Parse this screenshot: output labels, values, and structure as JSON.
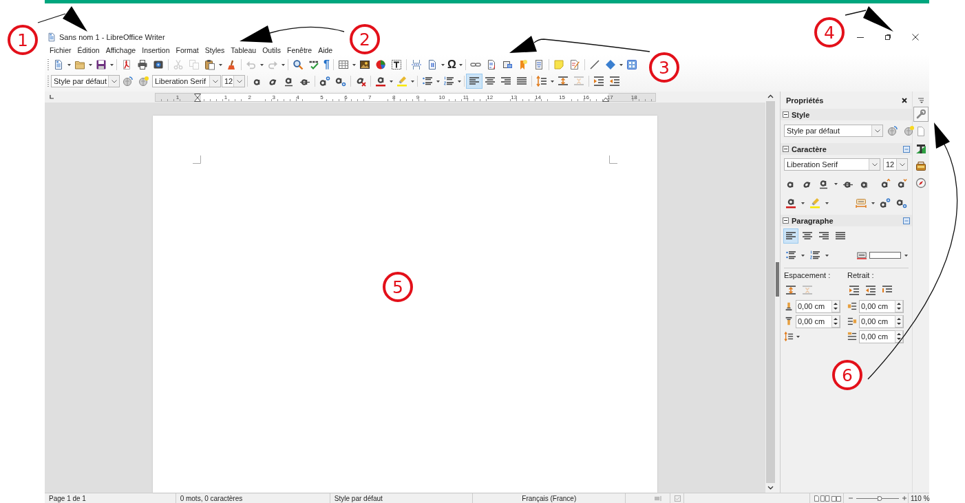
{
  "window": {
    "title": "Sans nom 1 - LibreOffice Writer"
  },
  "menu": [
    {
      "label": "Fichier"
    },
    {
      "label": "Édition"
    },
    {
      "label": "Affichage"
    },
    {
      "label": "Insertion"
    },
    {
      "label": "Format"
    },
    {
      "label": "Styles"
    },
    {
      "label": "Tableau"
    },
    {
      "label": "Outils"
    },
    {
      "label": "Fenêtre"
    },
    {
      "label": "Aide"
    }
  ],
  "toolbars": [
    {
      "groups": [
        [
          {
            "kind": "document",
            "dropdown": true,
            "disabled": false,
            "selected": false
          },
          {
            "kind": "folder",
            "dropdown": true,
            "disabled": false,
            "selected": false
          },
          {
            "kind": "floppy-disk",
            "dropdown": true,
            "disabled": false,
            "selected": false
          }
        ],
        [
          {
            "kind": "pdf",
            "disabled": false,
            "selected": false
          },
          {
            "kind": "printer",
            "disabled": false,
            "selected": false
          },
          {
            "kind": "print-preview",
            "disabled": false,
            "selected": false
          }
        ],
        [
          {
            "kind": "scissors",
            "disabled": true,
            "selected": false
          },
          {
            "kind": "copy",
            "disabled": true,
            "selected": false
          },
          {
            "kind": "clipboard",
            "dropdown": true,
            "disabled": false,
            "selected": false
          },
          {
            "kind": "brush",
            "disabled": false,
            "selected": false
          }
        ],
        [
          {
            "kind": "undo",
            "dropdown": true,
            "disabled": true,
            "selected": false
          },
          {
            "kind": "redo",
            "dropdown": true,
            "disabled": true,
            "selected": false
          }
        ],
        [
          {
            "kind": "magnifier",
            "disabled": false,
            "selected": false
          },
          {
            "kind": "spellcheck",
            "disabled": false,
            "selected": false
          },
          {
            "kind": "pilcrow",
            "text": "¶",
            "color": "#1f6fc9",
            "disabled": false,
            "selected": false
          }
        ],
        [
          {
            "kind": "table",
            "dropdown": true,
            "disabled": false,
            "selected": false
          },
          {
            "kind": "image",
            "disabled": false,
            "selected": false
          },
          {
            "kind": "pie-chart",
            "disabled": false,
            "selected": false
          },
          {
            "kind": "text-frame",
            "disabled": false,
            "selected": false
          }
        ],
        [
          {
            "kind": "page-break",
            "disabled": false,
            "selected": false
          },
          {
            "kind": "field",
            "dropdown": true,
            "disabled": false,
            "selected": false
          },
          {
            "kind": "omega",
            "text": "Ω",
            "color": "#222222",
            "dropdown": true,
            "disabled": false,
            "selected": false
          }
        ],
        [
          {
            "kind": "chain",
            "disabled": false,
            "selected": false
          },
          {
            "kind": "footnote",
            "disabled": false,
            "selected": false
          },
          {
            "kind": "endnote",
            "disabled": false,
            "selected": false
          },
          {
            "kind": "bookmark",
            "disabled": false,
            "selected": false
          },
          {
            "kind": "cross-reference",
            "disabled": false,
            "selected": false
          }
        ],
        [
          {
            "kind": "sticky-note",
            "disabled": false,
            "selected": false
          },
          {
            "kind": "track-changes",
            "disabled": false,
            "selected": false
          }
        ],
        [
          {
            "kind": "line",
            "disabled": false,
            "selected": false
          },
          {
            "kind": "diamond",
            "dropdown": true,
            "disabled": false,
            "selected": false
          },
          {
            "kind": "grid",
            "disabled": false,
            "selected": false
          }
        ]
      ]
    },
    {
      "groups": [
        [
          {
            "kind": "style-field",
            "value": "Style par défaut"
          },
          {
            "kind": "globe-refresh",
            "disabled": false,
            "selected": false
          },
          {
            "kind": "globe-star",
            "disabled": false,
            "selected": false
          },
          {
            "kind": "font-field",
            "value": "Liberation Serif"
          },
          {
            "kind": "size-field",
            "value": "12"
          }
        ],
        [
          {
            "kind": "bold",
            "disabled": false,
            "selected": false
          },
          {
            "kind": "italic",
            "disabled": false,
            "selected": false
          },
          {
            "kind": "underline",
            "disabled": false,
            "selected": false
          },
          {
            "kind": "strikethrough",
            "disabled": false,
            "selected": false
          }
        ],
        [
          {
            "kind": "superscript",
            "disabled": false,
            "selected": false
          },
          {
            "kind": "subscript",
            "disabled": false,
            "selected": false
          }
        ],
        [
          {
            "kind": "clear-formatting",
            "disabled": false,
            "selected": false
          }
        ],
        [
          {
            "kind": "font-color",
            "dropdown": true,
            "disabled": false,
            "selected": false
          },
          {
            "kind": "highlight",
            "dropdown": true,
            "disabled": false,
            "selected": false
          }
        ],
        [
          {
            "kind": "bullets",
            "dropdown": true,
            "disabled": false,
            "selected": false
          },
          {
            "kind": "numbering",
            "dropdown": true,
            "disabled": false,
            "selected": false
          }
        ],
        [
          {
            "kind": "align-left",
            "disabled": false,
            "selected": true
          },
          {
            "kind": "align-center",
            "disabled": false,
            "selected": false
          },
          {
            "kind": "align-right",
            "disabled": false,
            "selected": false
          },
          {
            "kind": "justify",
            "disabled": false,
            "selected": false
          }
        ],
        [
          {
            "kind": "line-spacing",
            "dropdown": true,
            "disabled": false,
            "selected": false
          },
          {
            "kind": "space-increase",
            "disabled": false,
            "selected": false
          },
          {
            "kind": "space-decrease",
            "disabled": true,
            "selected": false
          }
        ],
        [
          {
            "kind": "indent-increase",
            "disabled": false,
            "selected": false
          },
          {
            "kind": "indent-decrease",
            "disabled": false,
            "selected": false
          }
        ]
      ]
    }
  ],
  "ruler": {
    "labels": [
      "1",
      "1",
      "2",
      "3",
      "4",
      "5",
      "6",
      "7",
      "8",
      "9",
      "10",
      "11",
      "12",
      "13",
      "14",
      "15",
      "16",
      "17",
      "18"
    ]
  },
  "sidebar": {
    "title": "Propriétés",
    "style_section": {
      "title": "Style",
      "expanded": true,
      "style_box": "Style par défaut",
      "icons": [
        {
          "kind": "globe-refresh"
        },
        {
          "kind": "globe-star"
        }
      ]
    },
    "character_section": {
      "title": "Caractère",
      "expanded": true,
      "font_box": "Liberation Serif",
      "size_box": "12",
      "rows": [
        {
          "left": [
            {
              "kind": "bold"
            },
            {
              "kind": "italic"
            },
            {
              "kind": "underline",
              "dropdown": true
            },
            {
              "kind": "strikethrough"
            },
            {
              "kind": "shadow"
            }
          ],
          "right": [
            {
              "kind": "grow-font"
            },
            {
              "kind": "shrink-font"
            }
          ]
        },
        {
          "left": [
            {
              "kind": "font-color",
              "dropdown": true
            },
            {
              "kind": "highlight",
              "dropdown": true
            }
          ],
          "right": [
            {
              "kind": "char-spacing",
              "dropdown": true
            },
            {
              "kind": "superscript"
            },
            {
              "kind": "subscript"
            }
          ]
        }
      ]
    },
    "paragraph_section": {
      "title": "Paragraphe",
      "expanded": true,
      "align": [
        {
          "kind": "align-left",
          "selected": true
        },
        {
          "kind": "align-center",
          "selected": false
        },
        {
          "kind": "align-right",
          "selected": false
        },
        {
          "kind": "justify",
          "selected": false
        }
      ],
      "lists": [
        {
          "kind": "bullets",
          "dropdown": true
        },
        {
          "kind": "numbering",
          "dropdown": true
        }
      ],
      "spacing_label": "Espacement :",
      "indent_label": "Retrait :",
      "spacing_icons": [
        {
          "kind": "space-increase",
          "disabled": false
        },
        {
          "kind": "space-decrease",
          "disabled": true
        }
      ],
      "indent_icons": [
        {
          "kind": "indent-increase",
          "disabled": false
        },
        {
          "kind": "indent-decrease",
          "disabled": false
        },
        {
          "kind": "hanging-indent",
          "disabled": false
        }
      ],
      "spacing_fields": [
        {
          "kind": "space-above",
          "value": "0,00 cm"
        },
        {
          "kind": "space-below",
          "value": "0,00 cm"
        }
      ],
      "indent_fields": [
        {
          "kind": "indent-before",
          "value": "0,00 cm"
        },
        {
          "kind": "indent-after",
          "value": "0,00 cm"
        },
        {
          "kind": "first-line",
          "value": "0,00 cm"
        }
      ]
    }
  },
  "sidebar_tabs": [
    {
      "kind": "wrench",
      "selected": true
    },
    {
      "kind": "page",
      "selected": false
    },
    {
      "kind": "text-style",
      "selected": false
    },
    {
      "kind": "gallery",
      "selected": false
    },
    {
      "kind": "compass",
      "selected": false
    }
  ],
  "status_bar": {
    "page": "Page 1 de 1",
    "words": "0 mots, 0 caractères",
    "style": "Style par défaut",
    "language": "Français (France)",
    "zoom": {
      "level": 0.55,
      "reading": "110 %"
    }
  },
  "annotations": [
    {
      "label": "1"
    },
    {
      "label": "2"
    },
    {
      "label": "3"
    },
    {
      "label": "4"
    },
    {
      "label": "5"
    },
    {
      "label": "6"
    }
  ]
}
